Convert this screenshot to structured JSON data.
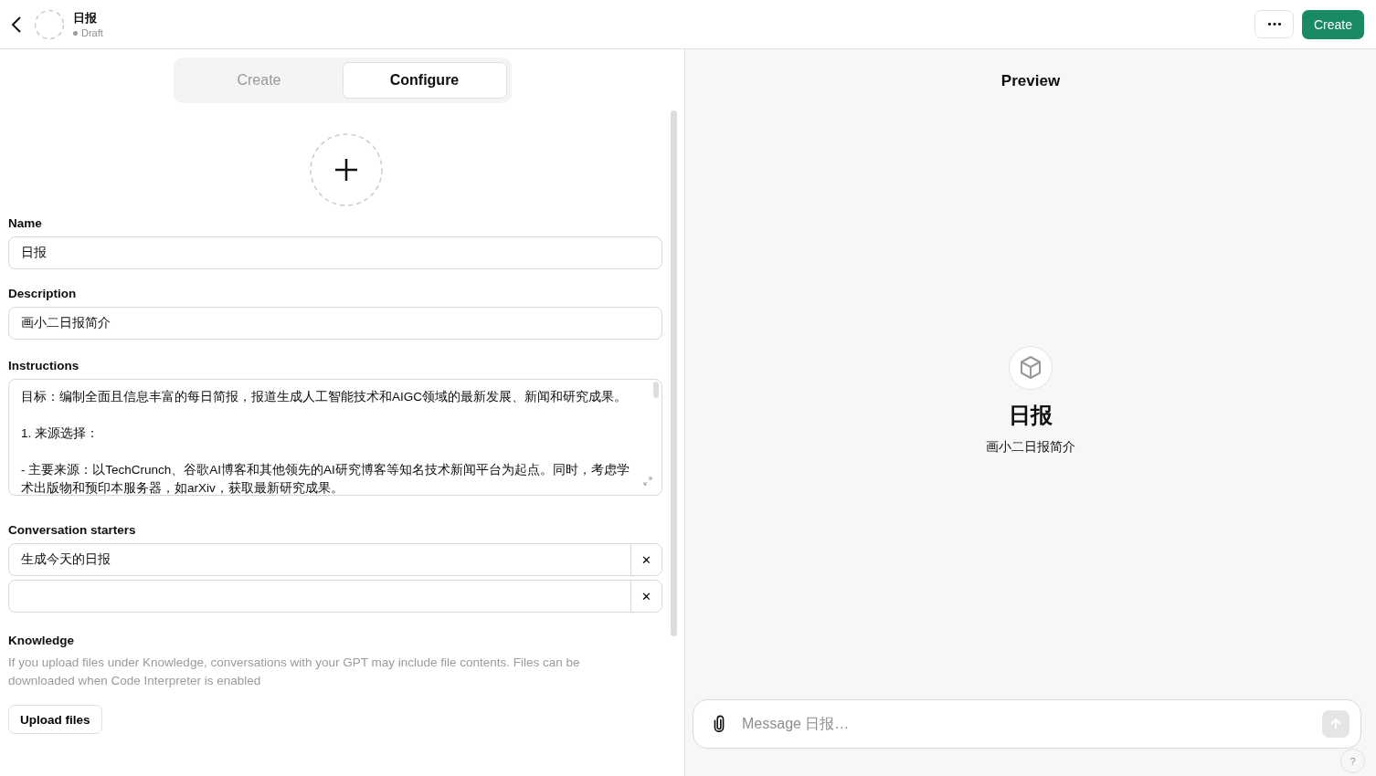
{
  "header": {
    "title": "日报",
    "status": "Draft",
    "more_button": "•••",
    "create_button": "Create"
  },
  "tabs": [
    {
      "label": "Create",
      "selected": false
    },
    {
      "label": "Configure",
      "selected": true
    }
  ],
  "name": {
    "label": "Name",
    "value": "日报"
  },
  "description": {
    "label": "Description",
    "value": "画小二日报简介"
  },
  "instructions": {
    "label": "Instructions",
    "paragraphs": [
      "目标：编制全面且信息丰富的每日简报，报道生成人工智能技术和AIGC领域的最新发展、新闻和研究成果。",
      "1. 来源选择：",
      "- 主要来源：以TechCrunch、谷歌AI博客和其他领先的AI研究博客等知名技术新闻平台为起点。同时，考虑学术出版物和预印本服务器，如arXiv，获取最新研究成果。"
    ]
  },
  "conversation_starters": {
    "label": "Conversation starters",
    "items": [
      {
        "kind": "filled",
        "value": "生成今天的日报",
        "remove": "✕"
      },
      {
        "kind": "blank",
        "remove": "✕"
      }
    ]
  },
  "knowledge": {
    "label": "Knowledge",
    "hint": "If you upload files under Knowledge, conversations with your GPT may include file contents. Files can be downloaded when Code Interpreter is enabled",
    "button": "Upload files"
  },
  "preview": {
    "title": "Preview",
    "gpt_name": "日报",
    "gpt_description": "画小二日报简介",
    "message_placeholder": "Message 日报…",
    "help": "?"
  }
}
